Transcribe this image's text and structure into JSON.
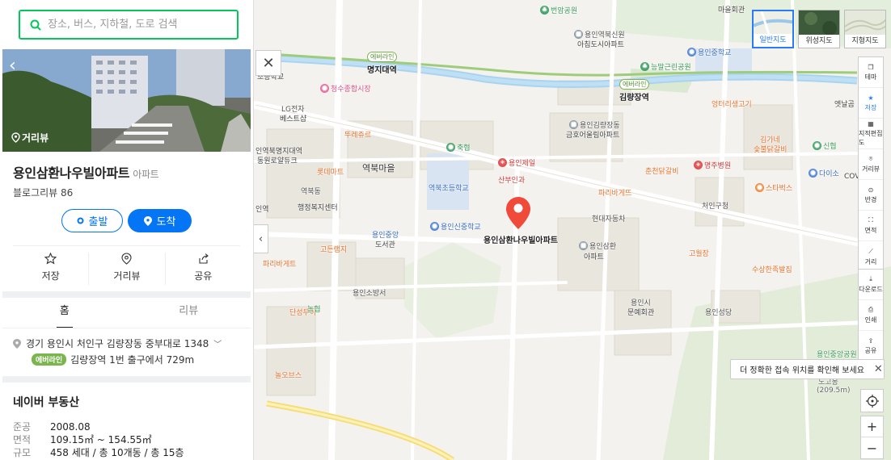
{
  "search": {
    "placeholder": "장소, 버스, 지하철, 도로 검색"
  },
  "place": {
    "streetview_label": "거리뷰",
    "name": "용인삼환나우빌아파트",
    "category": "아파트",
    "blog_review": "블로그리뷰 86",
    "start_label": "출발",
    "arrive_label": "도착",
    "actions": [
      {
        "label": "저장",
        "icon": "star-icon"
      },
      {
        "label": "거리뷰",
        "icon": "pin-outline-icon"
      },
      {
        "label": "공유",
        "icon": "share-icon"
      }
    ],
    "tabs": [
      "홈",
      "리뷰"
    ],
    "address": "경기 용인시 처인구 김량장동 중부대로 1348",
    "subway_line": "에버라인",
    "subway_text": "김량장역 1번 출구에서 729m",
    "real_estate_title": "네이버 부동산",
    "real_estate": [
      {
        "key": "준공",
        "value": "2008.08"
      },
      {
        "key": "면적",
        "value": "109.15㎡ ~ 154.55㎡"
      },
      {
        "key": "규모",
        "value": "458 세대 / 총 10개동 / 총 15층"
      }
    ]
  },
  "map": {
    "marker_label": "용인삼환나우빌아파트",
    "map_types": [
      {
        "label": "일반지도",
        "active": true
      },
      {
        "label": "위성지도",
        "active": false
      },
      {
        "label": "지형지도",
        "active": false
      }
    ],
    "tools": [
      "테마",
      "저장",
      "지적편집도",
      "거리뷰",
      "반경",
      "면적",
      "거리"
    ],
    "tools2": [
      "다운로드",
      "인쇄",
      "공유"
    ],
    "tip": "더 정확한 접속 위치를 확인해 보세요",
    "zoom_in": "+",
    "zoom_out": "−",
    "stations": [
      {
        "name": "명지대역",
        "line": "에버라인"
      },
      {
        "name": "김량장역",
        "line": "에버라인"
      }
    ],
    "labels": [
      "번암공원",
      "용인역북신원",
      "아침도시아파트",
      "용인중학교",
      "능말근린공원",
      "마을회관",
      "청수종합시장",
      "LG전자",
      "베스트샵",
      "용인김량장동",
      "금호어울림아파트",
      "엉터리생고기",
      "엣날곰",
      "뚜레쥬르",
      "인역북명지대역",
      "동원로얄듀크",
      "역북마을",
      "축협",
      "용인제일",
      "산부인과",
      "김가네",
      "숯불닭갈비",
      "신협",
      "롯데마트",
      "역북동",
      "행정복지센터",
      "역북초등학교",
      "춘천닭갈비",
      "명주병원",
      "다이소",
      "파리바게뜨",
      "스타벅스",
      "처인구청",
      "현대자동차",
      "용인신중학교",
      "용인중앙",
      "도서관",
      "고든램지",
      "파리바게트",
      "용인삼환",
      "아파트",
      "고월장",
      "수상한족발집",
      "용인소방서",
      "단성무이",
      "농협",
      "용인시",
      "문예회관",
      "용인성당",
      "용인중앙공원",
      "놀오브스",
      "노고봉",
      "(209.5m)",
      "인역",
      "초등학교",
      "COV"
    ]
  },
  "colors": {
    "accent": "#03c75a",
    "blue": "#0475f4",
    "pin": "#f04a3a",
    "everline": "#7bb54d"
  }
}
